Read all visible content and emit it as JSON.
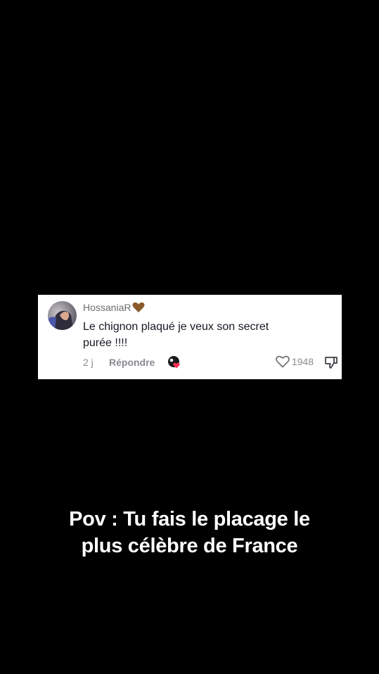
{
  "comment": {
    "username": "HossaniaR",
    "username_emoji": "brown-heart",
    "text_line1": "Le chignon plaqué je veux son secret",
    "text_line2": "purée !!!!",
    "time": "2 j",
    "reply_label": "Répondre",
    "like_count": "1948",
    "accent_color": "#fe2c55"
  },
  "caption": {
    "line1": "Pov : Tu fais le placage le",
    "line2": "plus célèbre de France"
  }
}
